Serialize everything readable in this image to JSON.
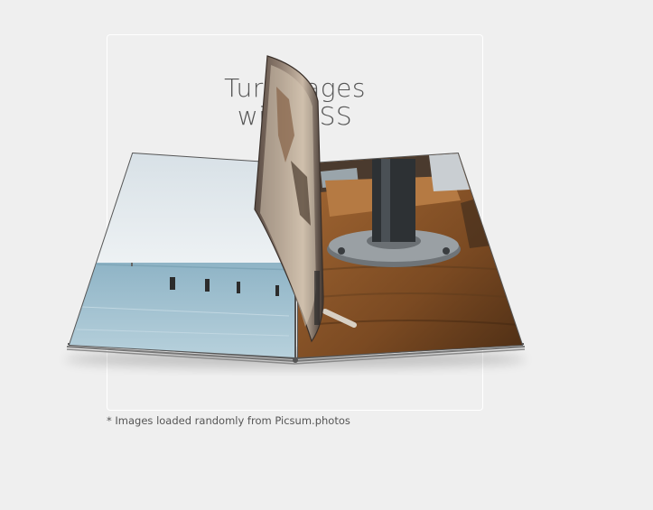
{
  "title": {
    "line1": "Turn pages",
    "line2": "with CSS"
  },
  "footnote": "* Images loaded randomly from Picsum.photos",
  "pages": {
    "left": {
      "scene": "seascape with wooden posts in water"
    },
    "right": {
      "scene": "metal pipe flange on wooden desk"
    },
    "turning": {
      "scene": "flipping page photo"
    }
  },
  "colors": {
    "background": "#efefef",
    "frame": "#ffffff",
    "text": "#555555"
  }
}
